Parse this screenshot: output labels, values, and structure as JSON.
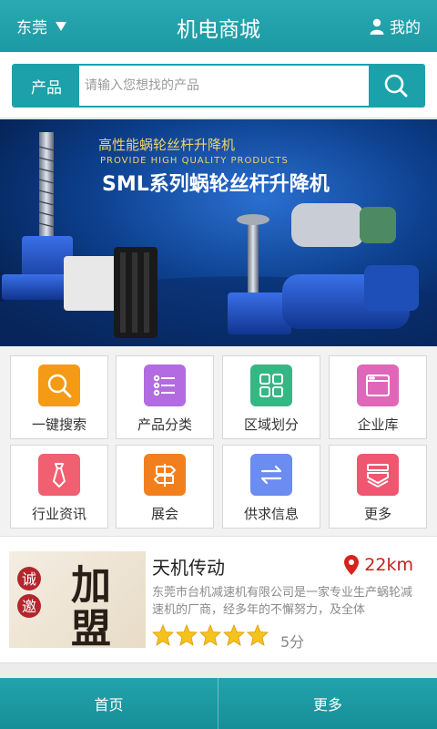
{
  "header": {
    "city": "东莞",
    "title": "机电商城",
    "mine": "我的"
  },
  "search": {
    "category": "产品",
    "placeholder": "请输入您想找的产品"
  },
  "banner": {
    "line1": "高性能蜗轮丝杆升降机",
    "line2": "PROVIDE HIGH QUALITY PRODUCTS",
    "line3": "SML系列蜗轮丝杆升降机"
  },
  "grid": [
    {
      "label": "一键搜索",
      "icon": "search-icon",
      "color": "#f59a14"
    },
    {
      "label": "产品分类",
      "icon": "list-icon",
      "color": "#b26be0"
    },
    {
      "label": "区域划分",
      "icon": "grid-icon",
      "color": "#35b783"
    },
    {
      "label": "企业库",
      "icon": "browser-window-icon",
      "color": "#e066b8"
    },
    {
      "label": "行业资讯",
      "icon": "necktie-icon",
      "color": "#f06070"
    },
    {
      "label": "展会",
      "icon": "signpost-icon",
      "color": "#f27f1e"
    },
    {
      "label": "供求信息",
      "icon": "exchange-arrows-icon",
      "color": "#6b8cf0"
    },
    {
      "label": "更多",
      "icon": "stacked-layers-icon",
      "color": "#f0566f"
    }
  ],
  "listing": {
    "name": "天机传动",
    "distance": "22km",
    "description": "东莞市台机减速机有限公司是一家专业生产蜗轮减速机的厂商，经多年的不懈努力，及全体",
    "rating": 5,
    "score": "5分",
    "thumb_text": {
      "small1": "诚",
      "small2": "邀",
      "big1": "加",
      "big2": "盟"
    }
  },
  "tabs": {
    "home": "首页",
    "more": "更多"
  }
}
